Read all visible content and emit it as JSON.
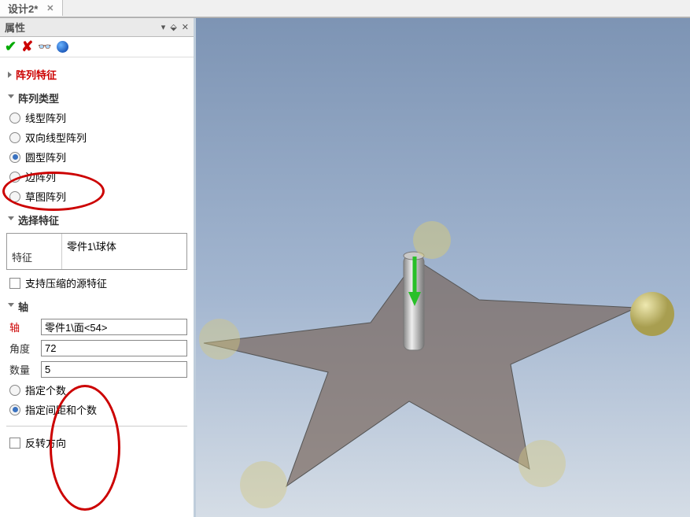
{
  "tab_label": "设计2*",
  "panel": {
    "title": "属性"
  },
  "sections": {
    "pattern_feature": "阵列特征",
    "pattern_type": "阵列类型",
    "type_options": {
      "linear": "线型阵列",
      "bidir": "双向线型阵列",
      "circular": "圆型阵列",
      "edge": "边阵列",
      "sketch": "草图阵列"
    },
    "select_feature": "选择特征",
    "feature_label": "特征",
    "feature_value": "零件1\\球体",
    "support_compressed": "支持压缩的源特征",
    "axis_section": "轴",
    "axis_label": "轴",
    "axis_value": "零件1\\面<54>",
    "angle_label": "角度",
    "angle_value": "72",
    "count_label": "数量",
    "count_value": "5",
    "specify_count": "指定个数",
    "specify_pitch_count": "指定间距和个数",
    "reverse_dir": "反转方向"
  }
}
